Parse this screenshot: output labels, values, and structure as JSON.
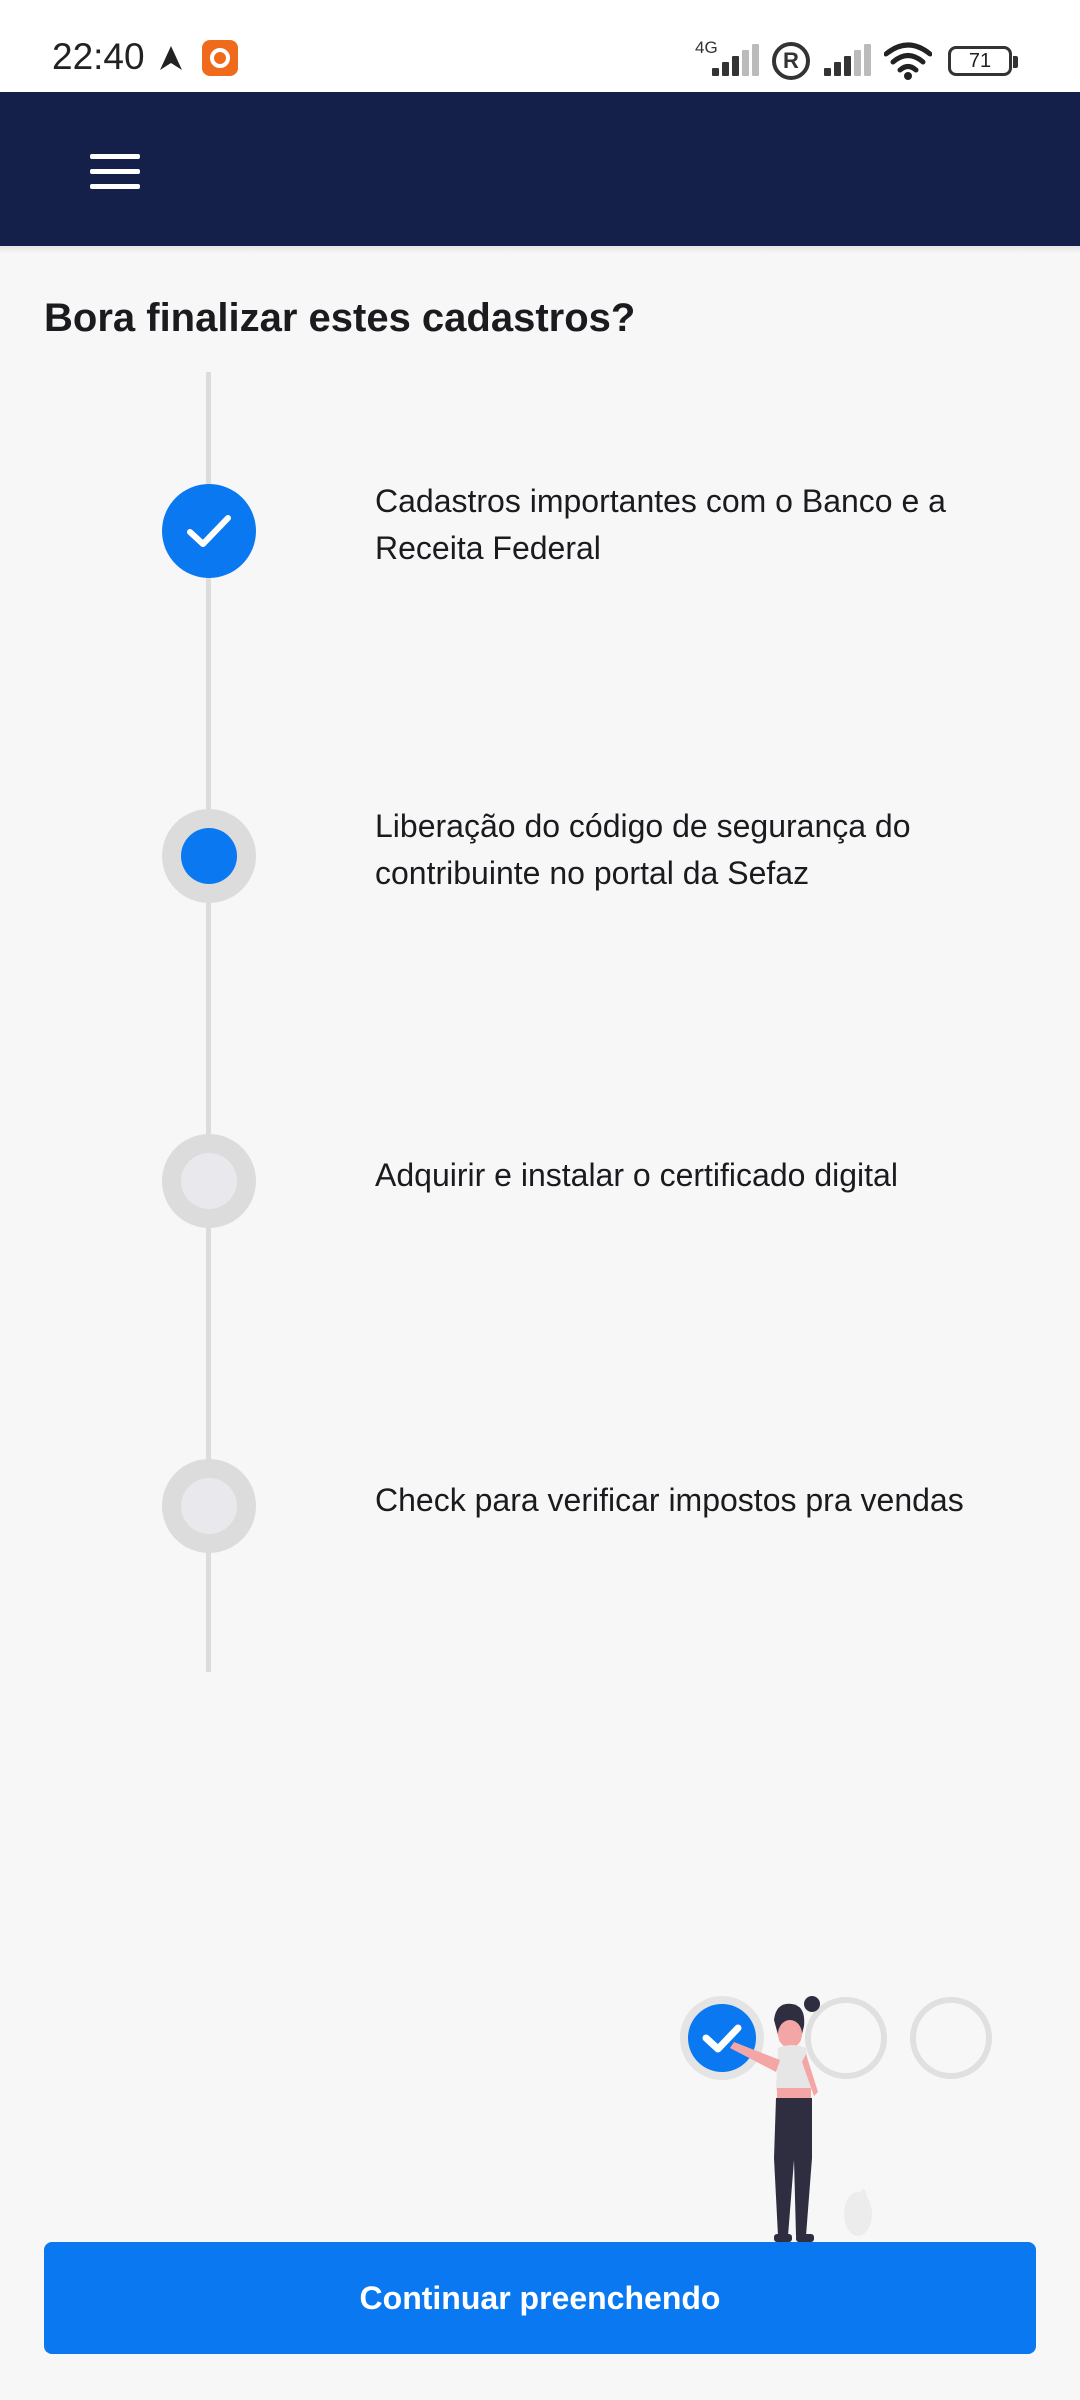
{
  "status_bar": {
    "time": "22:40",
    "network_label": "4G",
    "battery": "71",
    "icons": [
      "navigation-arrow-icon",
      "screen-recorder-icon",
      "signal-icon",
      "registered-icon",
      "signal-icon",
      "wifi-icon",
      "battery-icon"
    ]
  },
  "header": {
    "menu_icon": "hamburger-menu-icon",
    "background_color": "#15204a"
  },
  "page": {
    "title": "Bora finalizar estes cadastros?"
  },
  "steps": [
    {
      "label": "Cadastros importantes com o Banco e a Receita Federal",
      "status": "done"
    },
    {
      "label": "Liberação do código de segurança do contribuinte no portal da Sefaz",
      "status": "current"
    },
    {
      "label": "Adquirir e instalar o certificado digital",
      "status": "todo"
    },
    {
      "label": "Check para verificar impostos pra vendas",
      "status": "todo"
    }
  ],
  "illustration": {
    "icon": "woman-checklist-illustration"
  },
  "cta": {
    "label": "Continuar preenchendo",
    "color": "#0a78f0"
  }
}
